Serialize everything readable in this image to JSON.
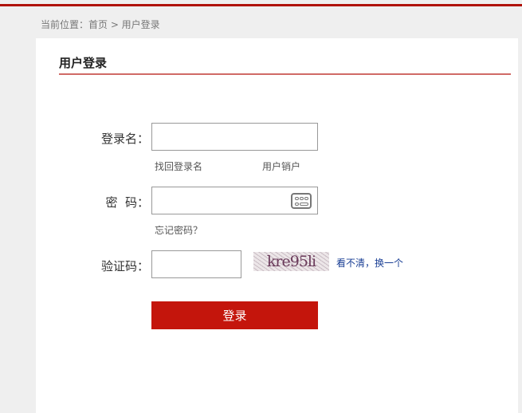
{
  "breadcrumb": "当前位置：首页 > 用户登录",
  "title": "用户登录",
  "form": {
    "username_label": "登录名：",
    "username_value": "",
    "find_username": "找回登录名",
    "cancel_account": "用户销户",
    "password_label": "密  码：",
    "password_value": "",
    "forgot_password": "忘记密码？",
    "captcha_label": "验证码：",
    "captcha_value": "",
    "captcha_text": "kre95li",
    "refresh_captcha": "看不清，换一个",
    "submit": "登录"
  },
  "colors": {
    "accent": "#c4150c",
    "link": "#1a3f95"
  },
  "icons": {
    "keyboard": "keyboard-icon"
  }
}
